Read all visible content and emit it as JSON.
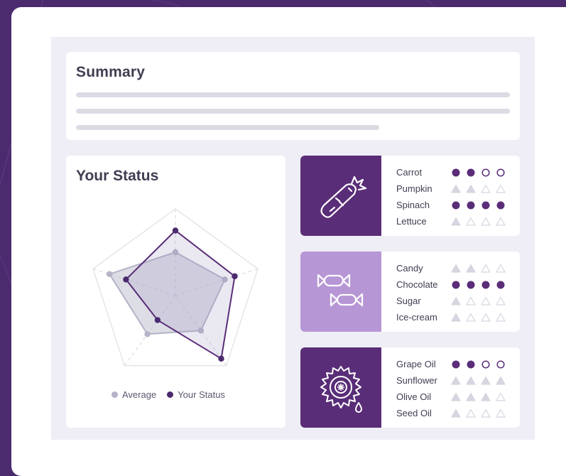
{
  "summary": {
    "title": "Summary"
  },
  "status": {
    "title": "Your Status",
    "legend": [
      {
        "label": "Average",
        "color": "#b4b3c8"
      },
      {
        "label": "Your Status",
        "color": "#4b2a6e"
      }
    ],
    "radar": {
      "axes": 5,
      "scale_max": 1,
      "average": [
        0.5,
        0.6,
        0.5,
        0.55,
        0.8
      ],
      "your_status": [
        0.75,
        0.72,
        0.9,
        0.35,
        0.6
      ]
    }
  },
  "colors": {
    "accent": "#5a2d78",
    "accent_light": "#b796d5",
    "muted_mark": "#d6d5e0",
    "background": "#4b2a6e",
    "panel": "#efeef6"
  },
  "categories": [
    {
      "icon": "carrot-icon",
      "style": "dark",
      "items": [
        {
          "label": "Carrot",
          "type": "circle",
          "level": 2
        },
        {
          "label": "Pumpkin",
          "type": "triangle",
          "level": 2
        },
        {
          "label": "Spinach",
          "type": "circle",
          "level": 4
        },
        {
          "label": "Lettuce",
          "type": "triangle",
          "level": 1
        }
      ]
    },
    {
      "icon": "candy-icon",
      "style": "light",
      "items": [
        {
          "label": "Candy",
          "type": "triangle",
          "level": 2
        },
        {
          "label": "Chocolate",
          "type": "circle",
          "level": 4
        },
        {
          "label": "Sugar",
          "type": "triangle",
          "level": 1
        },
        {
          "label": "Ice-cream",
          "type": "triangle",
          "level": 1
        }
      ]
    },
    {
      "icon": "sunflower-icon",
      "style": "dark",
      "items": [
        {
          "label": "Grape Oil",
          "type": "circle",
          "level": 2
        },
        {
          "label": "Sunflower",
          "type": "triangle",
          "level": 4
        },
        {
          "label": "Olive Oil",
          "type": "triangle",
          "level": 3
        },
        {
          "label": "Seed Oil",
          "type": "triangle",
          "level": 1
        }
      ]
    }
  ]
}
